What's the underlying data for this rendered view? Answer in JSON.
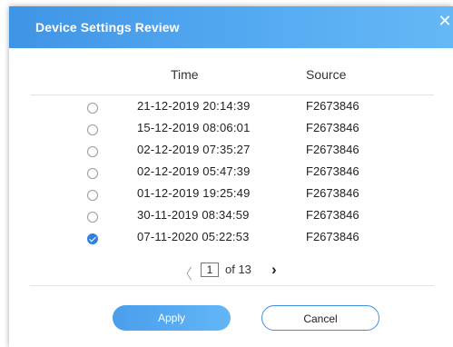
{
  "dialog": {
    "title": "Device Settings Review",
    "close_icon": "close-icon"
  },
  "table": {
    "columns": [
      "Time",
      "Source"
    ],
    "rows": [
      {
        "time": "21-12-2019 20:14:39",
        "source": "F2673846",
        "selected": false
      },
      {
        "time": "15-12-2019 08:06:01",
        "source": "F2673846",
        "selected": false
      },
      {
        "time": "02-12-2019 07:35:27",
        "source": "F2673846",
        "selected": false
      },
      {
        "time": "02-12-2019 05:47:39",
        "source": "F2673846",
        "selected": false
      },
      {
        "time": "01-12-2019 19:25:49",
        "source": "F2673846",
        "selected": false
      },
      {
        "time": "30-11-2019 08:34:59",
        "source": "F2673846",
        "selected": false
      },
      {
        "time": "07-11-2020 05:22:53",
        "source": "F2673846",
        "selected": true
      }
    ]
  },
  "pagination": {
    "current_page": "1",
    "of_label": "of 13",
    "prev_icon": "chevron-left-icon",
    "next_icon": "chevron-right-icon"
  },
  "buttons": {
    "apply_label": "Apply",
    "cancel_label": "Cancel"
  },
  "colors": {
    "header_start": "#3f95e5",
    "header_end": "#65b8f6",
    "accent": "#2f7fde"
  }
}
